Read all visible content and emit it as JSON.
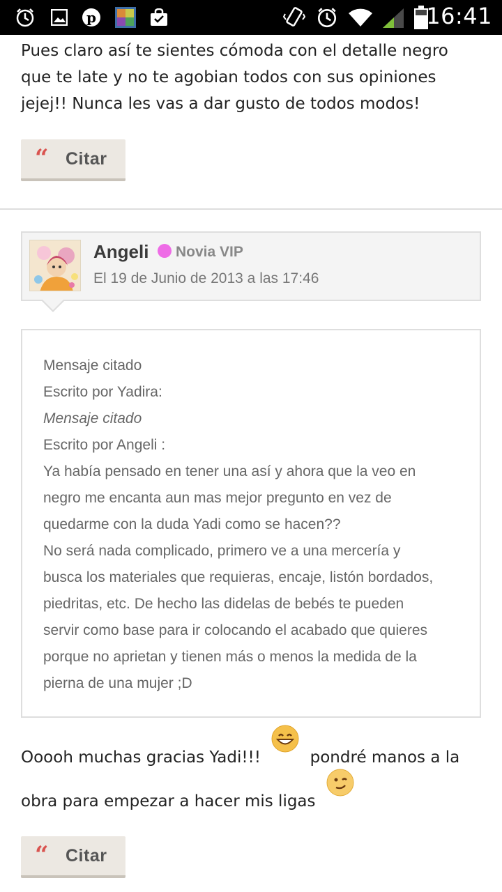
{
  "status_bar": {
    "time": "16:41",
    "icons": [
      "alarm-icon",
      "image-icon",
      "pinterest-icon",
      "app-thumbnail-icon",
      "shopping-bag-icon",
      "vibrate-icon",
      "alarm-icon",
      "wifi-icon",
      "signal-icon",
      "battery-icon"
    ]
  },
  "previous_post": {
    "text_lines": [
      "Pues claro así te sientes cómoda con el detalle negro",
      "que te late y no te agobian todos con sus opiniones",
      "jejej!! Nunca les vas a dar gusto de todos modos!"
    ],
    "quote_button": {
      "icon": "“",
      "label": "Citar"
    }
  },
  "post": {
    "author": {
      "name": "Angeli",
      "badge": "Novia VIP",
      "badge_color": "#ee6ce6",
      "date": "El 19 de Junio de 2013 a las 17:46"
    },
    "quoted": {
      "lines": [
        "Mensaje citado",
        "Escrito por Yadira:",
        "Mensaje citado",
        "Escrito por Angeli :",
        "Ya había pensado en tener una así y ahora que la veo en",
        "negro me encanta aun mas mejor pregunto en vez de",
        "quedarme con la duda Yadi como se hacen??",
        "No será nada complicado, primero ve a una mercería y",
        "busca los materiales que requieras, encaje, listón bordados,",
        "piedritas, etc. De hecho las didelas de bebés te pueden",
        "servir como base para ir colocando el acabado que quieres",
        "porque no aprietan y tienen más o menos la medida de la",
        "pierna de una mujer ;D"
      ]
    },
    "body": {
      "line1_before": "Ooooh muchas gracias Yadi!!!",
      "line1_after": "pondré manos a la",
      "line2": "obra para empezar a hacer mis ligas",
      "emojis": [
        "grinning-emoji",
        "wink-emoji"
      ]
    },
    "quote_button": {
      "icon": "“",
      "label": "Citar"
    }
  },
  "colors": {
    "accent_quote": "#d9534f",
    "button_bg": "#ece8e2",
    "status_bar_bg": "#000000"
  }
}
